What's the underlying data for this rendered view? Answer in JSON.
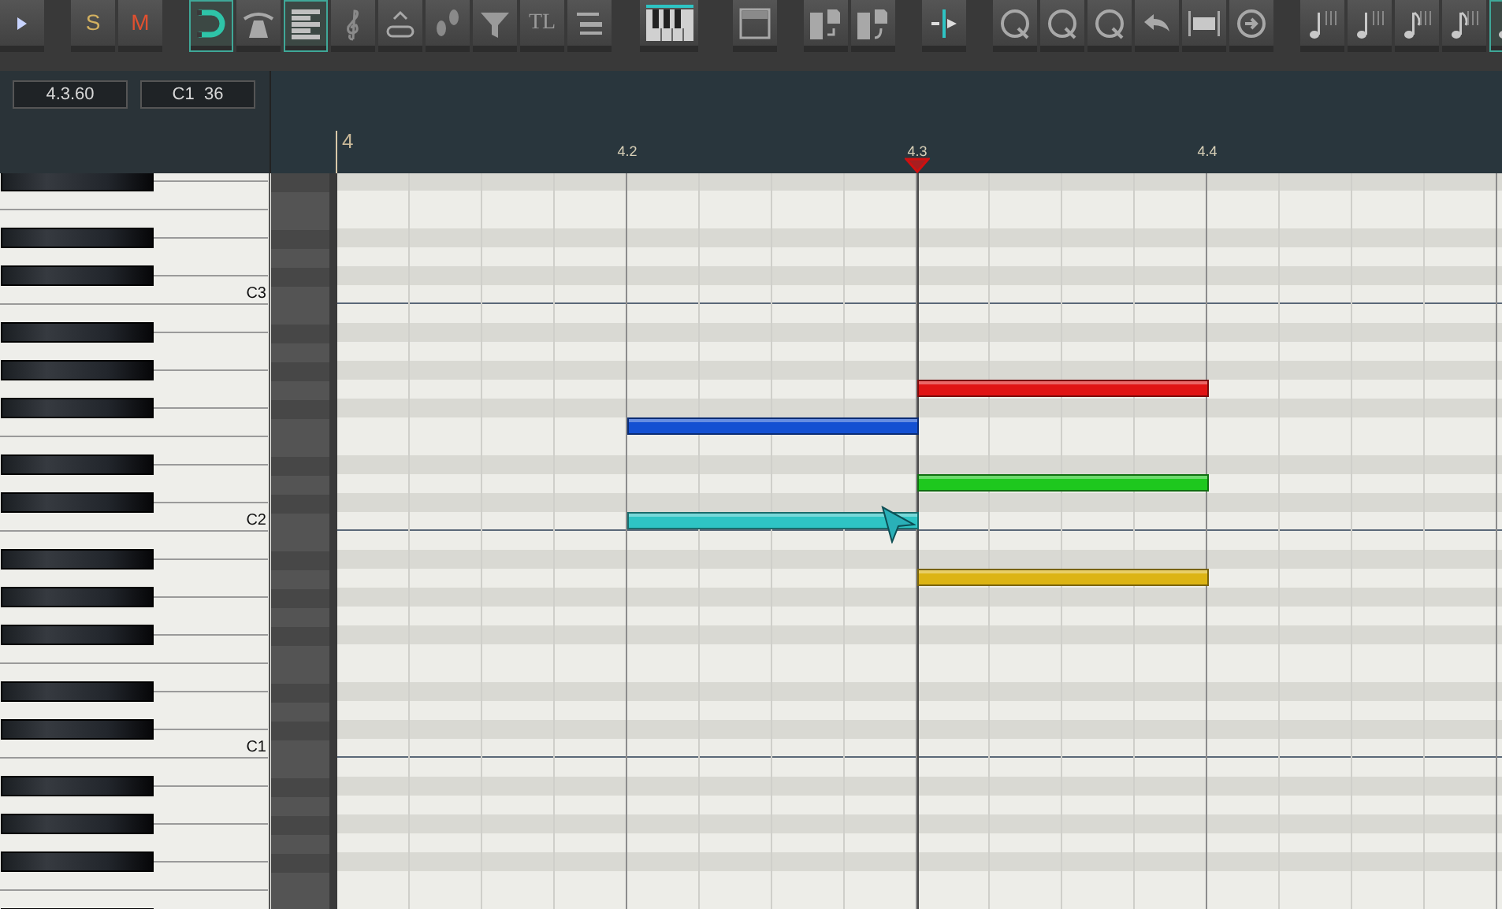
{
  "toolbar": {
    "groups": [
      [
        {
          "kind": "icon",
          "selected": false
        }
      ],
      [
        {
          "kind": "text",
          "label": "S",
          "selected": false
        },
        {
          "kind": "text",
          "label": "M",
          "selected": false
        }
      ],
      [
        {
          "kind": "icon",
          "selected": true
        },
        {
          "kind": "icon",
          "selected": false
        },
        {
          "kind": "icon",
          "selected": true
        },
        {
          "kind": "icon",
          "selected": false
        },
        {
          "kind": "icon",
          "selected": false
        },
        {
          "kind": "icon",
          "selected": false
        },
        {
          "kind": "icon",
          "selected": false
        },
        {
          "kind": "text",
          "label": "TL",
          "selected": false
        },
        {
          "kind": "icon",
          "selected": false
        }
      ],
      [
        {
          "kind": "icon",
          "selected": false
        }
      ],
      [
        {
          "kind": "icon",
          "selected": false
        }
      ],
      [
        {
          "kind": "icon",
          "selected": false
        },
        {
          "kind": "icon",
          "selected": false
        }
      ],
      [
        {
          "kind": "icon",
          "selected": false
        }
      ],
      [
        {
          "kind": "icon",
          "selected": false
        },
        {
          "kind": "icon",
          "selected": false
        },
        {
          "kind": "icon",
          "selected": false
        },
        {
          "kind": "icon",
          "selected": false
        },
        {
          "kind": "icon",
          "selected": false
        },
        {
          "kind": "icon",
          "selected": false
        }
      ],
      [
        {
          "kind": "icon",
          "selected": false
        },
        {
          "kind": "icon",
          "selected": false
        },
        {
          "kind": "icon",
          "selected": false
        },
        {
          "kind": "icon",
          "selected": false
        },
        {
          "kind": "icon",
          "selected": true
        }
      ]
    ]
  },
  "fields": [
    {
      "value": "4.3.60"
    },
    {
      "value": "C1  36"
    }
  ],
  "ruler": [
    {
      "label": "4",
      "kind": "bar"
    },
    {
      "label": "4.2",
      "kind": "beat"
    },
    {
      "label": "4.3",
      "kind": "beat"
    },
    {
      "label": "4.4",
      "kind": "beat"
    }
  ],
  "keyboard": {
    "labels": [
      {
        "text": "C3"
      },
      {
        "text": "C2"
      },
      {
        "text": "C1"
      }
    ]
  },
  "notes": [
    {
      "color": "#e01414"
    },
    {
      "color": "#1450d2"
    },
    {
      "color": "#1ec81e"
    },
    {
      "color": "#2ec4c4"
    },
    {
      "color": "#dcb414"
    }
  ]
}
